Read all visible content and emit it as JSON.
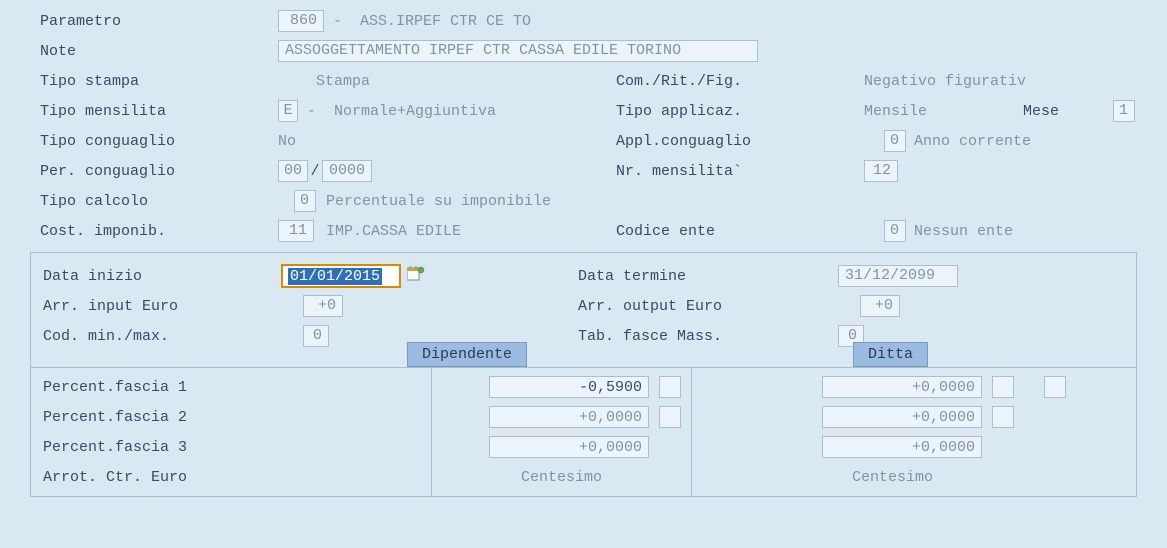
{
  "labels": {
    "parametro": "Parametro",
    "note": "Note",
    "tipo_stampa": "Tipo stampa",
    "tipo_mensilita": "Tipo mensilita",
    "tipo_conguaglio": "Tipo conguaglio",
    "per_conguaglio": "Per. conguaglio",
    "tipo_calcolo": "Tipo calcolo",
    "cost_imponib": "Cost. imponib.",
    "com_rit_fig": "Com./Rit./Fig.",
    "tipo_applicaz": "Tipo applicaz.",
    "appl_conguaglio": "Appl.conguaglio",
    "nr_mensilita": "Nr. mensilita`",
    "codice_ente": "Codice ente",
    "data_inizio": "Data inizio",
    "arr_input_euro": "Arr. input Euro",
    "cod_min_max": "Cod. min./max.",
    "data_termine": "Data termine",
    "arr_output_euro": "Arr. output Euro",
    "tab_fasce_mass": "Tab. fasce Mass.",
    "dipendente": "Dipendente",
    "ditta": "Ditta",
    "percent_fascia_1": "Percent.fascia 1",
    "percent_fascia_2": "Percent.fascia 2",
    "percent_fascia_3": "Percent.fascia 3",
    "arrot_ctr_euro": "Arrot. Ctr. Euro",
    "centesimo": "Centesimo",
    "mese": "Mese",
    "slash": "/"
  },
  "values": {
    "parametro_code": "860",
    "parametro_desc": " -  ASS.IRPEF CTR CE TO",
    "note": "ASSOGGETTAMENTO IRPEF CTR CASSA EDILE TORINO",
    "tipo_stampa_desc": "Stampa",
    "com_rit_fig_desc": "Negativo figurativ",
    "tipo_mensilita_code": "E",
    "tipo_mensilita_desc": " -  Normale+Aggiuntiva",
    "tipo_applicaz_desc": "Mensile",
    "mese_code": "1",
    "tipo_conguaglio_desc": "No",
    "appl_conguaglio_code": "0",
    "appl_conguaglio_desc": "Anno corrente",
    "per_conguaglio_mm": "00",
    "per_conguaglio_yyyy": "0000",
    "nr_mensilita": "12",
    "tipo_calcolo_code": "0",
    "tipo_calcolo_desc": "Percentuale su imponibile",
    "cost_imponib_code": "11",
    "cost_imponib_desc": "IMP.CASSA EDILE",
    "codice_ente_code": "0",
    "codice_ente_desc": "Nessun ente",
    "data_inizio": "01/01/2015",
    "data_termine": "31/12/2099",
    "arr_input_euro": "+0",
    "arr_output_euro": "+0",
    "cod_min_max": "0",
    "tab_fasce_mass": "0",
    "dip_f1": "-0,5900",
    "dip_f2": "+0,0000",
    "dip_f3": "+0,0000",
    "dit_f1": "+0,0000",
    "dit_f2": "+0,0000",
    "dit_f3": "+0,0000"
  }
}
